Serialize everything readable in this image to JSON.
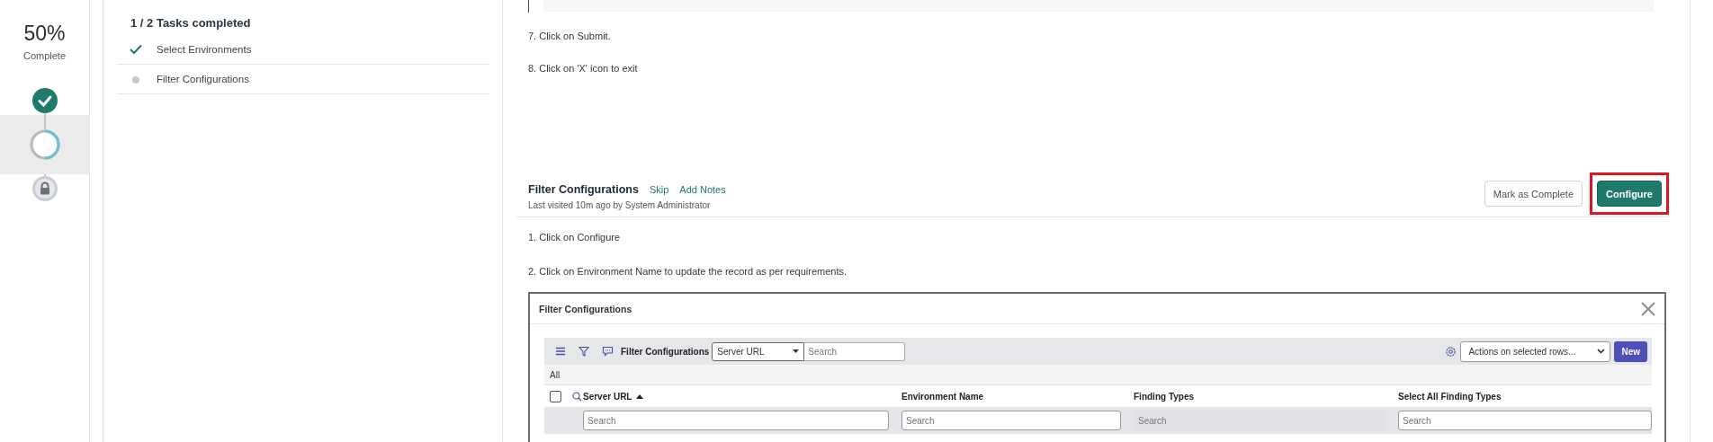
{
  "progress": {
    "percent": "50%",
    "label": "Complete",
    "steps": [
      {
        "kind": "done",
        "selected": false
      },
      {
        "kind": "current",
        "selected": true
      },
      {
        "kind": "locked",
        "selected": false
      }
    ]
  },
  "tasks": {
    "heading": "1 / 2 Tasks completed",
    "items": [
      {
        "label": "Select Environments",
        "done": true
      },
      {
        "label": "Filter Configurations",
        "done": false
      }
    ]
  },
  "instructions_top": [
    "7. Click on Submit.",
    "8. Click on 'X' icon to exit"
  ],
  "section": {
    "title": "Filter Configurations",
    "links": [
      "Skip",
      "Add Notes"
    ],
    "visited": "Last visited 10m ago by System Administrator",
    "buttons": [
      {
        "label": "Mark as Complete",
        "kind": "secondary",
        "highlighted": false
      },
      {
        "label": "Configure",
        "kind": "primary",
        "highlighted": true
      }
    ]
  },
  "instructions": [
    "1. Click on Configure",
    "2. Click on Environment Name to update the record as per requirements."
  ],
  "embedded": {
    "title": "Filter Configurations",
    "list_title": "Filter Configurations",
    "field_select": "Server URL",
    "search_placeholder": "Search",
    "actions_select": "Actions on selected rows...",
    "new_button": "New",
    "breadcrumb": "All",
    "select_all_checked": false,
    "columns": [
      {
        "label": "Server URL",
        "sorted": true,
        "placeholder": "Search",
        "disabled": false
      },
      {
        "label": "Environment Name",
        "sorted": false,
        "placeholder": "Search",
        "disabled": false
      },
      {
        "label": "Finding Types",
        "sorted": false,
        "placeholder": "Search",
        "disabled": true
      },
      {
        "label": "Select All Finding Types",
        "sorted": false,
        "placeholder": "Search",
        "disabled": false
      }
    ]
  }
}
